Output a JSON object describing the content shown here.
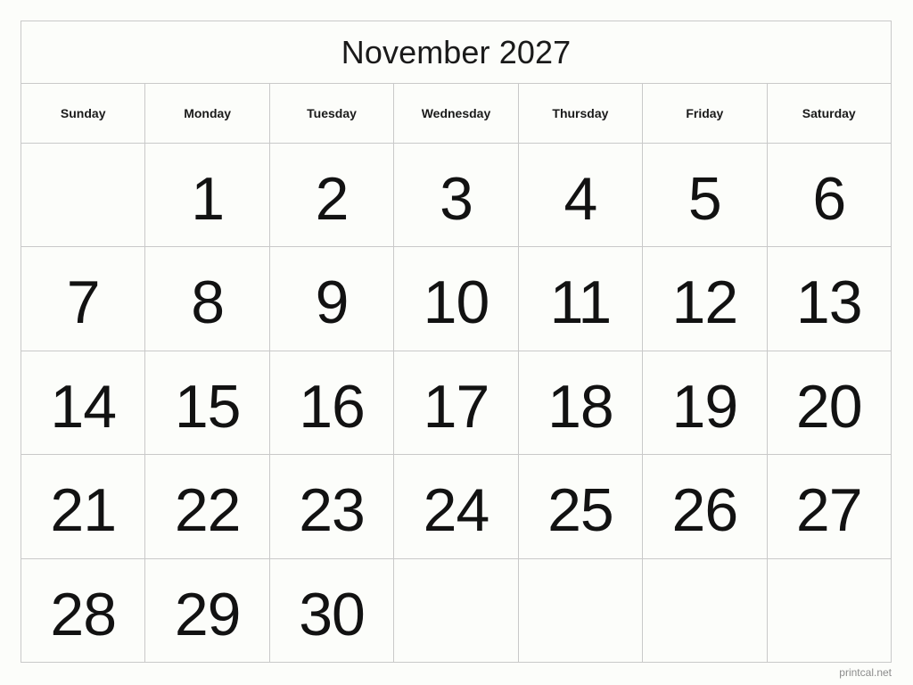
{
  "page": {
    "background_color": "#fcfdfa",
    "border_color": "#c9c9c9"
  },
  "calendar": {
    "title": "November 2027",
    "month": "November",
    "year": "2027",
    "weekdays": [
      "Sunday",
      "Monday",
      "Tuesday",
      "Wednesday",
      "Thursday",
      "Friday",
      "Saturday"
    ],
    "weeks": [
      [
        {
          "day": ""
        },
        {
          "day": "1"
        },
        {
          "day": "2"
        },
        {
          "day": "3"
        },
        {
          "day": "4"
        },
        {
          "day": "5"
        },
        {
          "day": "6"
        }
      ],
      [
        {
          "day": "7"
        },
        {
          "day": "8"
        },
        {
          "day": "9"
        },
        {
          "day": "10"
        },
        {
          "day": "11"
        },
        {
          "day": "12"
        },
        {
          "day": "13"
        }
      ],
      [
        {
          "day": "14"
        },
        {
          "day": "15"
        },
        {
          "day": "16"
        },
        {
          "day": "17"
        },
        {
          "day": "18"
        },
        {
          "day": "19"
        },
        {
          "day": "20"
        }
      ],
      [
        {
          "day": "21"
        },
        {
          "day": "22"
        },
        {
          "day": "23"
        },
        {
          "day": "24"
        },
        {
          "day": "25"
        },
        {
          "day": "26"
        },
        {
          "day": "27"
        }
      ],
      [
        {
          "day": "28"
        },
        {
          "day": "29"
        },
        {
          "day": "30"
        },
        {
          "day": ""
        },
        {
          "day": ""
        },
        {
          "day": ""
        },
        {
          "day": ""
        }
      ]
    ]
  },
  "footer": {
    "credit": "printcal.net"
  }
}
